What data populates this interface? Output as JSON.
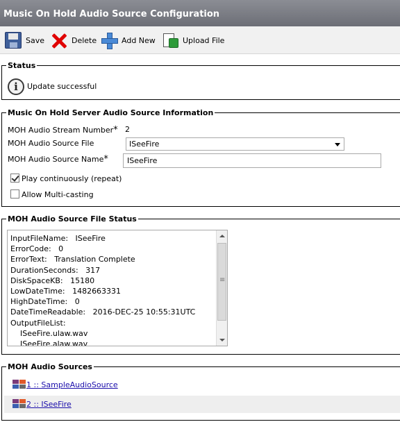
{
  "page": {
    "title": "Music On Hold Audio Source Configuration"
  },
  "toolbar": {
    "save_label": "Save",
    "delete_label": "Delete",
    "add_new_label": "Add New",
    "upload_label": "Upload File"
  },
  "status": {
    "legend": "Status",
    "message": "Update successful",
    "icon": "info-icon"
  },
  "server_info": {
    "legend": "Music On Hold Server Audio Source Information",
    "stream_number_label": "MOH Audio Stream Number",
    "stream_number_required": "*",
    "stream_number_value": "2",
    "source_file_label": "MOH Audio Source File",
    "source_file_value": "ISeeFire",
    "source_name_label": "MOH Audio Source Name",
    "source_name_required": "*",
    "source_name_value": "ISeeFire",
    "play_continuously_label": "Play continuously (repeat)",
    "play_continuously_checked": true,
    "allow_multicast_label": "Allow Multi-casting",
    "allow_multicast_checked": false
  },
  "file_status": {
    "legend": "MOH Audio Source File Status",
    "lines": [
      "InputFileName:   ISeeFire",
      "ErrorCode:   0",
      "ErrorText:   Translation Complete",
      "DurationSeconds:   317",
      "DiskSpaceKB:   15180",
      "LowDateTime:   1482663331",
      "HighDateTime:   0",
      "DateTimeReadable:   2016-DEC-25 10:55:31UTC",
      "OutputFileList:",
      "    ISeeFire.ulaw.wav",
      "    ISeeFire.alaw.wav"
    ]
  },
  "sources": {
    "legend": "MOH Audio Sources",
    "items": [
      {
        "label": "1 :: SampleAudioSource"
      },
      {
        "label": "2 :: ISeeFire"
      }
    ]
  }
}
